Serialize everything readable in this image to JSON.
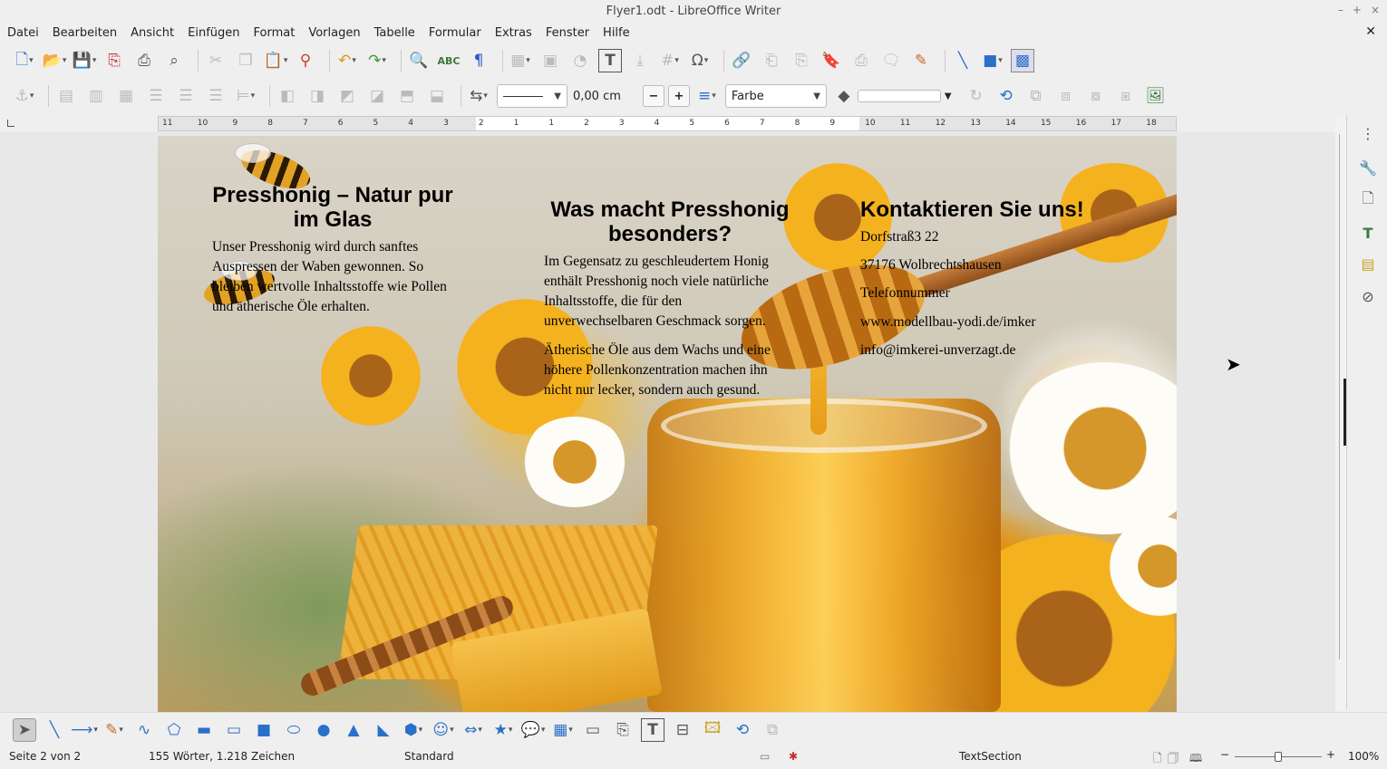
{
  "window": {
    "title": "Flyer1.odt - LibreOffice Writer",
    "min": "–",
    "max": "+",
    "close": "×"
  },
  "menu": [
    "Datei",
    "Bearbeiten",
    "Ansicht",
    "Einfügen",
    "Format",
    "Vorlagen",
    "Tabelle",
    "Formular",
    "Extras",
    "Fenster",
    "Hilfe"
  ],
  "menu_close": "✕",
  "toolbar2": {
    "line_width": "0,00 cm",
    "fill_type": "Farbe"
  },
  "ruler": {
    "ticks": [
      "11",
      "10",
      "9",
      "8",
      "7",
      "6",
      "5",
      "4",
      "3",
      "2",
      "1",
      "1",
      "2",
      "3",
      "4",
      "5",
      "6",
      "7",
      "8",
      "9",
      "10",
      "11",
      "12",
      "13",
      "14",
      "15",
      "16",
      "17",
      "18"
    ]
  },
  "document": {
    "col1": {
      "heading": "Presshonig – Natur pur im Glas",
      "body": "Unser Presshonig wird durch sanftes Auspressen der Waben gewonnen. So bleiben wertvolle Inhaltsstoffe wie Pollen und ätherische Öle erhalten."
    },
    "col2": {
      "heading": "Was macht Presshonig besonders?",
      "body1": "Im Gegensatz zu geschleudertem Honig enthält Presshonig noch viele natürliche Inhaltsstoffe, die für den unverwechselbaren Geschmack sorgen.",
      "body2": "Ätherische Öle aus dem Wachs und eine höhere Pollenkonzentration machen ihn nicht nur lecker, sondern auch gesund."
    },
    "col3": {
      "heading": "Kontaktieren Sie uns!",
      "lines": [
        "Dorfstraß3 22",
        "37176 Wolbrechtshausen",
        "Telefonnummer",
        "www.modellbau-yodi.de/imker",
        "info@imkerei-unverzagt.de"
      ]
    }
  },
  "status": {
    "page": "Seite 2 von 2",
    "words": "155 Wörter, 1.218 Zeichen",
    "style": "Standard",
    "section": "TextSection",
    "zoom": "100%",
    "zoom_value": 100
  }
}
